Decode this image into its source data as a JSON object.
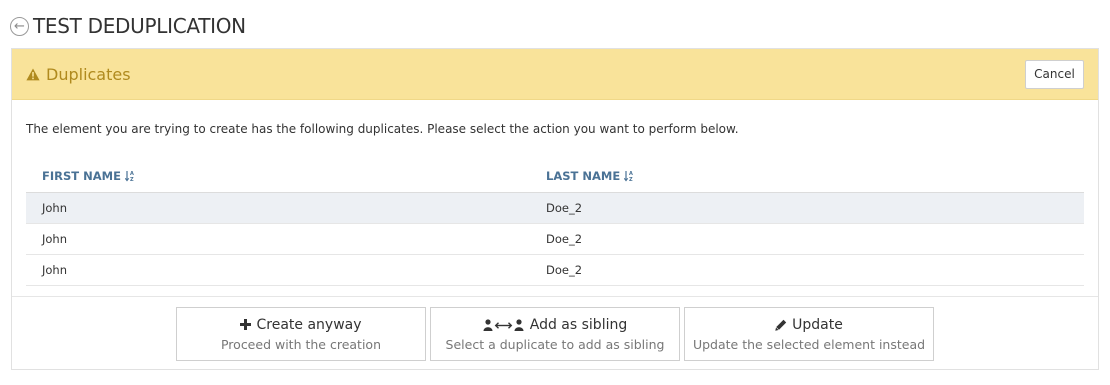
{
  "page": {
    "title": "TEST DEDUPLICATION",
    "back_icon": "arrow-circle-left-icon"
  },
  "panel": {
    "heading": "Duplicates",
    "heading_icon": "warning-icon",
    "heading_color": "#b08a1e",
    "heading_bg": "#f9e39a",
    "cancel_label": "Cancel"
  },
  "message": "The element you are trying to create has the following duplicates. Please select the action you want to perform below.",
  "table": {
    "columns": [
      "FIRST NAME",
      "LAST NAME"
    ],
    "rows": [
      {
        "first": "John",
        "last": "Doe_2",
        "selected": true
      },
      {
        "first": "John",
        "last": "Doe_2",
        "selected": false
      },
      {
        "first": "John",
        "last": "Doe_2",
        "selected": false
      }
    ]
  },
  "actions": [
    {
      "icon": "plus-icon",
      "label": "Create anyway",
      "sub": "Proceed with the creation"
    },
    {
      "icon": "user-link-user-icon",
      "label": "Add as sibling",
      "sub": "Select a duplicate to add as sibling"
    },
    {
      "icon": "pencil-icon",
      "label": "Update",
      "sub": "Update the selected element instead"
    }
  ]
}
